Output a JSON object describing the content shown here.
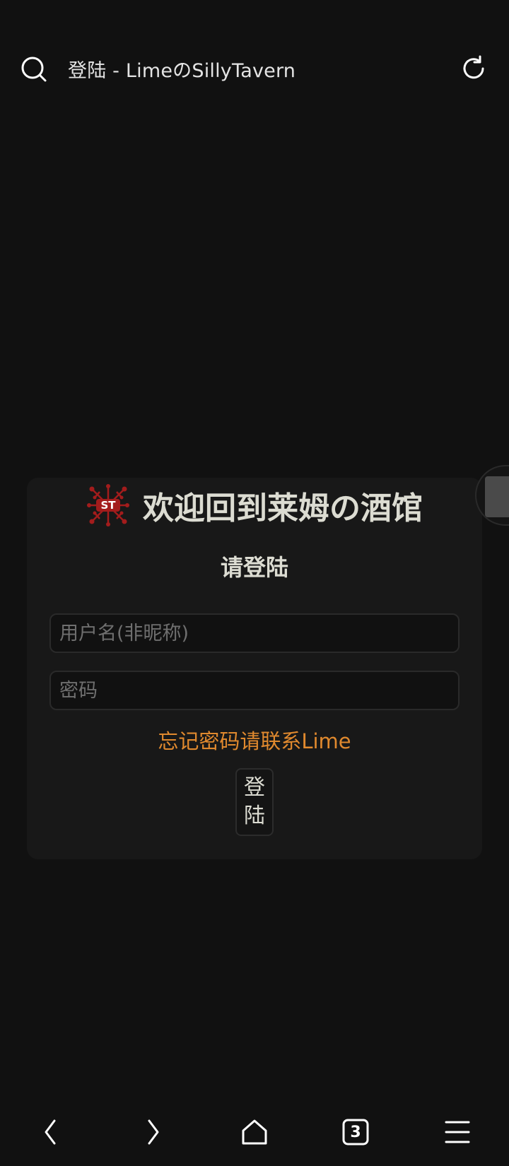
{
  "browser": {
    "page_title": "登陆 - LimeのSillyTavern",
    "tabs_count": "3"
  },
  "login": {
    "logo_text": "ST",
    "brand_title": "欢迎回到莱姆の酒馆",
    "heading": "请登陆",
    "username_placeholder": "用户名(非昵称)",
    "password_placeholder": "密码",
    "forgot_text": "忘记密码请联系Lime",
    "submit_label": "登陆"
  },
  "colors": {
    "background": "#111111",
    "card": "#181818",
    "accent_orange": "#e0892e",
    "logo_red": "#a31c1c"
  }
}
